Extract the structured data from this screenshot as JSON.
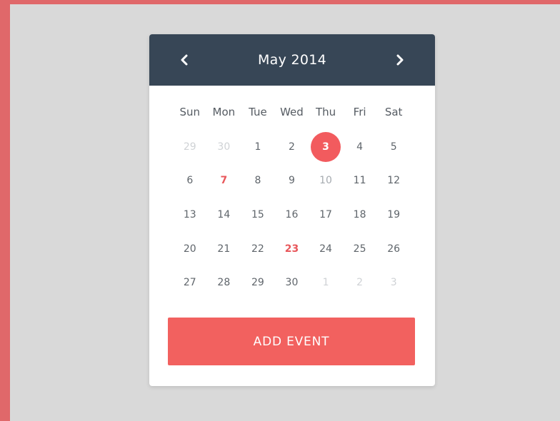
{
  "calendar": {
    "title": "May 2014",
    "prev_icon": "chevron-left-icon",
    "next_icon": "chevron-right-icon",
    "weekdays": [
      "Sun",
      "Mon",
      "Tue",
      "Wed",
      "Thu",
      "Fri",
      "Sat"
    ],
    "weeks": [
      [
        {
          "label": "29",
          "state": "muted"
        },
        {
          "label": "30",
          "state": "muted"
        },
        {
          "label": "1",
          "state": "normal"
        },
        {
          "label": "2",
          "state": "normal"
        },
        {
          "label": "3",
          "state": "selected"
        },
        {
          "label": "4",
          "state": "normal"
        },
        {
          "label": "5",
          "state": "normal"
        }
      ],
      [
        {
          "label": "6",
          "state": "normal"
        },
        {
          "label": "7",
          "state": "event"
        },
        {
          "label": "8",
          "state": "normal"
        },
        {
          "label": "9",
          "state": "normal"
        },
        {
          "label": "10",
          "state": "light"
        },
        {
          "label": "11",
          "state": "normal"
        },
        {
          "label": "12",
          "state": "normal"
        }
      ],
      [
        {
          "label": "13",
          "state": "normal"
        },
        {
          "label": "14",
          "state": "normal"
        },
        {
          "label": "15",
          "state": "normal"
        },
        {
          "label": "16",
          "state": "normal"
        },
        {
          "label": "17",
          "state": "normal"
        },
        {
          "label": "18",
          "state": "normal"
        },
        {
          "label": "19",
          "state": "normal"
        }
      ],
      [
        {
          "label": "20",
          "state": "normal"
        },
        {
          "label": "21",
          "state": "normal"
        },
        {
          "label": "22",
          "state": "normal"
        },
        {
          "label": "23",
          "state": "event"
        },
        {
          "label": "24",
          "state": "normal"
        },
        {
          "label": "25",
          "state": "normal"
        },
        {
          "label": "26",
          "state": "normal"
        }
      ],
      [
        {
          "label": "27",
          "state": "normal"
        },
        {
          "label": "28",
          "state": "normal"
        },
        {
          "label": "29",
          "state": "normal"
        },
        {
          "label": "30",
          "state": "normal"
        },
        {
          "label": "1",
          "state": "muted"
        },
        {
          "label": "2",
          "state": "muted"
        },
        {
          "label": "3",
          "state": "muted"
        }
      ]
    ]
  },
  "actions": {
    "add_event_label": "ADD EVENT"
  },
  "colors": {
    "header_bg": "#374656",
    "accent": "#f25b5e",
    "frame": "#e0686a",
    "page_bg": "#d9d9d9"
  }
}
